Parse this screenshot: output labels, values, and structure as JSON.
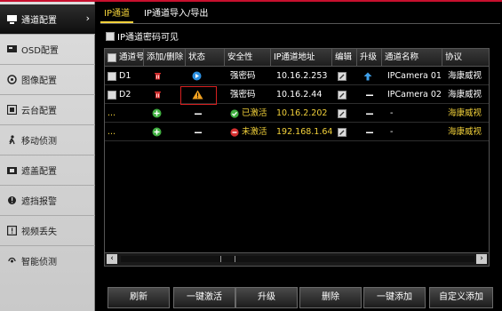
{
  "sidebar": {
    "items": [
      {
        "label": "通道配置",
        "icon": "channel-icon"
      },
      {
        "label": "OSD配置",
        "icon": "osd-icon"
      },
      {
        "label": "图像配置",
        "icon": "image-icon"
      },
      {
        "label": "云台配置",
        "icon": "ptz-icon"
      },
      {
        "label": "移动侦测",
        "icon": "motion-icon"
      },
      {
        "label": "遮盖配置",
        "icon": "mask-icon"
      },
      {
        "label": "遮挡报警",
        "icon": "tamper-icon"
      },
      {
        "label": "视频丢失",
        "icon": "video-loss-icon"
      },
      {
        "label": "智能侦测",
        "icon": "smart-icon"
      }
    ]
  },
  "tabs": [
    {
      "label": "IP通道"
    },
    {
      "label": "IP通道导入/导出"
    }
  ],
  "password_visible": {
    "label": "IP通道密码可见"
  },
  "table": {
    "headers": [
      "通道号",
      "添加/删除",
      "状态",
      "安全性",
      "IP通道地址",
      "编辑",
      "升级",
      "通道名称",
      "协议"
    ],
    "rows": [
      {
        "channel": "D1",
        "security": "强密码",
        "ip": "10.16.2.253",
        "name": "IPCamera 01",
        "protocol": "海康威视"
      },
      {
        "channel": "D2",
        "security": "强密码",
        "ip": "10.16.2.44",
        "name": "IPCamera 02",
        "protocol": "海康威视"
      },
      {
        "channel": "...",
        "security": "已激活",
        "ip": "10.16.2.202",
        "name": "-",
        "protocol": "海康威视"
      },
      {
        "channel": "...",
        "security": "未激活",
        "ip": "192.168.1.64",
        "name": "-",
        "protocol": "海康威视"
      }
    ]
  },
  "buttons": {
    "refresh": "刷新",
    "one_key_activate": "一键激活",
    "upgrade": "升级",
    "delete": "删除",
    "one_key_add": "一键添加",
    "custom_add": "自定义添加"
  },
  "colors": {
    "accent": "#f2d13a",
    "brand_red": "#c8102e",
    "status_blue": "#2b8fe0",
    "ok_green": "#3fae3f",
    "warn_orange": "#f0a020"
  }
}
